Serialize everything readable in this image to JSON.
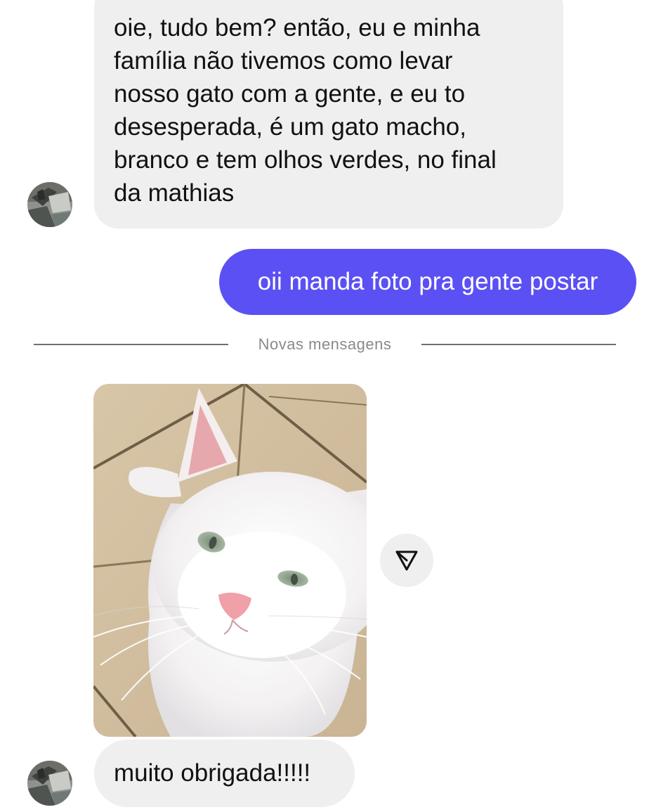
{
  "messages": {
    "first": {
      "lines": [
        "oie, tudo bem? então, eu e minha",
        "família não tivemos como levar",
        "nosso gato com a gente, e eu to",
        "desesperada, é um gato macho,",
        "branco e tem olhos verdes, no final",
        "da mathias"
      ]
    },
    "reply": "oii manda foto pra gente postar",
    "divider_label": "Novas mensagens",
    "last": "muito obrigada!!!!!"
  },
  "colors": {
    "incoming_bubble": "#efefef",
    "outgoing_bubble": "#5b50f3",
    "divider": "#6f6f6f",
    "divider_text": "#8a8a8a"
  },
  "icons": {
    "share": "send-arrow-icon",
    "avatar": "user-avatar"
  },
  "media": {
    "photo_subject": "white cat with green eyes"
  }
}
